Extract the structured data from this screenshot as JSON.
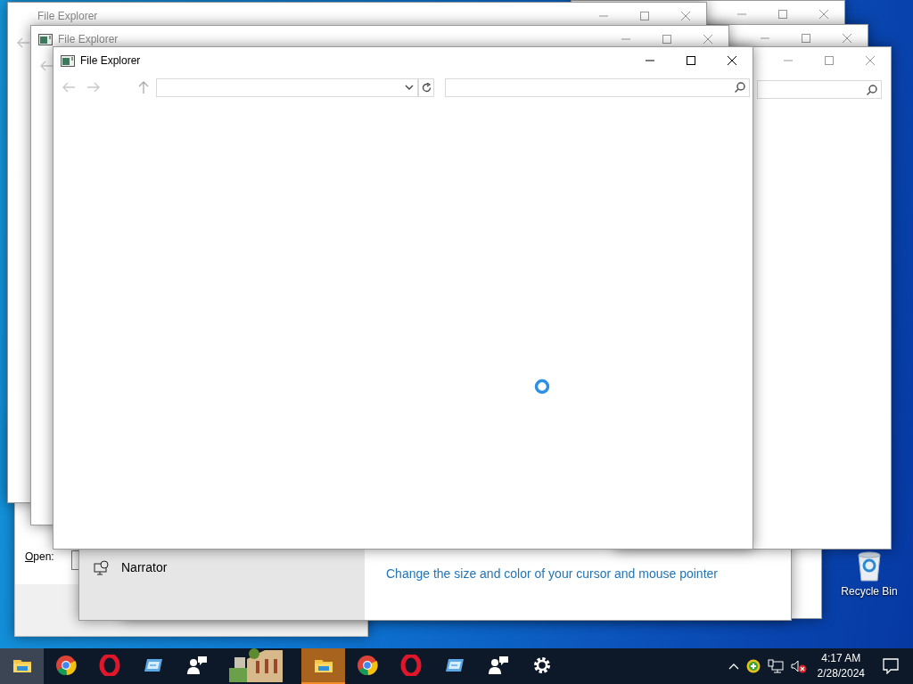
{
  "desktop_icons": [
    {
      "label": "Recycle Bin"
    }
  ],
  "run_dialog": {
    "open_label": "Open:"
  },
  "settings_window": {
    "sidebar_items": [
      {
        "label": "Narrator"
      }
    ],
    "link": "Change the size and color of your cursor and mouse pointer"
  },
  "explorer_windows": [
    {
      "title": "File Explorer",
      "active": false
    },
    {
      "title": "File Explorer",
      "active": false
    },
    {
      "title": "File Explorer",
      "active": true
    }
  ],
  "taskbar": {
    "items": [
      {
        "kind": "explorer",
        "active": true,
        "flashing": false
      },
      {
        "kind": "chrome",
        "active": false,
        "flashing": false
      },
      {
        "kind": "opera",
        "active": false,
        "flashing": false
      },
      {
        "kind": "app",
        "active": false,
        "flashing": false
      },
      {
        "kind": "people",
        "active": false,
        "flashing": false
      },
      {
        "kind": "picture",
        "active": false,
        "flashing": false
      },
      {
        "kind": "explorer",
        "active": false,
        "flashing": true
      },
      {
        "kind": "chrome",
        "active": false,
        "flashing": false
      },
      {
        "kind": "opera",
        "active": false,
        "flashing": false
      },
      {
        "kind": "app",
        "active": false,
        "flashing": false
      },
      {
        "kind": "people",
        "active": false,
        "flashing": false
      },
      {
        "kind": "settings",
        "active": false,
        "flashing": false
      }
    ],
    "clock": {
      "time": "4:17 AM",
      "date": "2/28/2024"
    }
  }
}
